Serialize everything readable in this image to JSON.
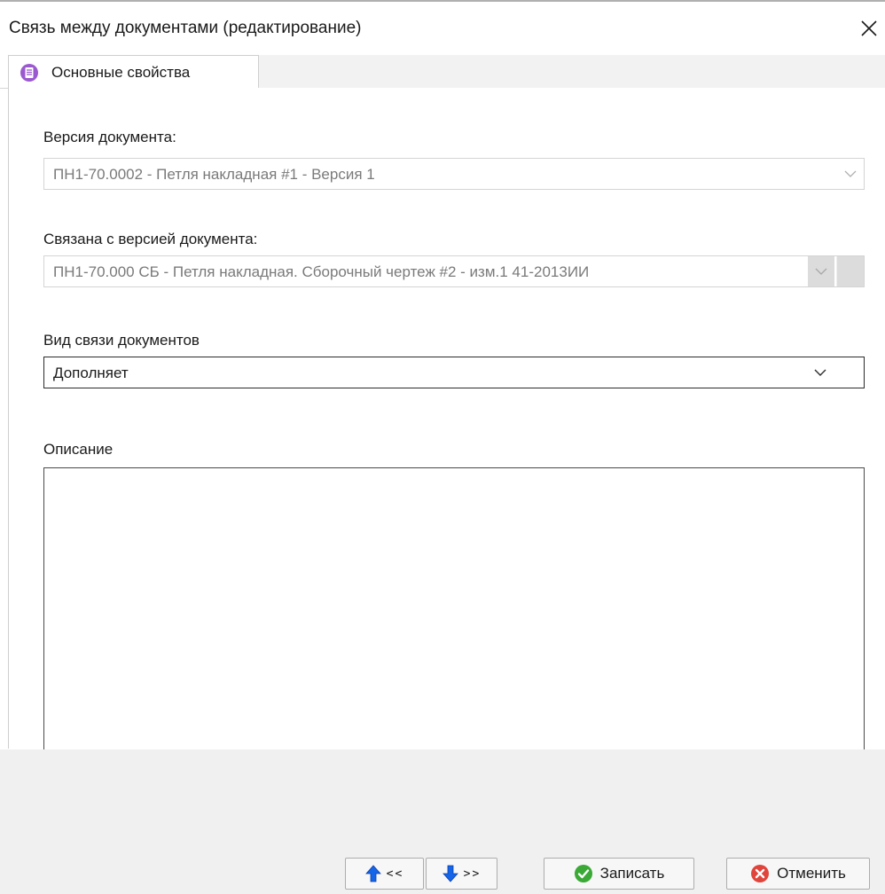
{
  "window": {
    "title": "Связь между документами (редактирование)"
  },
  "tabs": [
    {
      "label": "Основные свойства",
      "icon": "document-list-icon",
      "active": true
    }
  ],
  "fields": {
    "doc_version": {
      "label": "Версия документа:",
      "value": "ПН1-70.0002 - Петля накладная #1 - Версия 1",
      "enabled": false
    },
    "linked_version": {
      "label": "Связана с версией документа:",
      "value": "ПН1-70.000 СБ - Петля накладная. Сборочный чертеж #2 - изм.1 41-2013ИИ",
      "enabled": false
    },
    "link_type": {
      "label": "Вид связи документов",
      "value": "Дополняет",
      "enabled": true
    },
    "description": {
      "label": "Описание",
      "value": ""
    }
  },
  "footer": {
    "prev_label": "<<",
    "next_label": ">>",
    "save_label": "Записать",
    "cancel_label": "Отменить"
  },
  "colors": {
    "tab_icon": "#9b59d0",
    "nav_arrow": "#1565e8",
    "save_icon": "#3aa935",
    "cancel_icon": "#e0443b"
  }
}
